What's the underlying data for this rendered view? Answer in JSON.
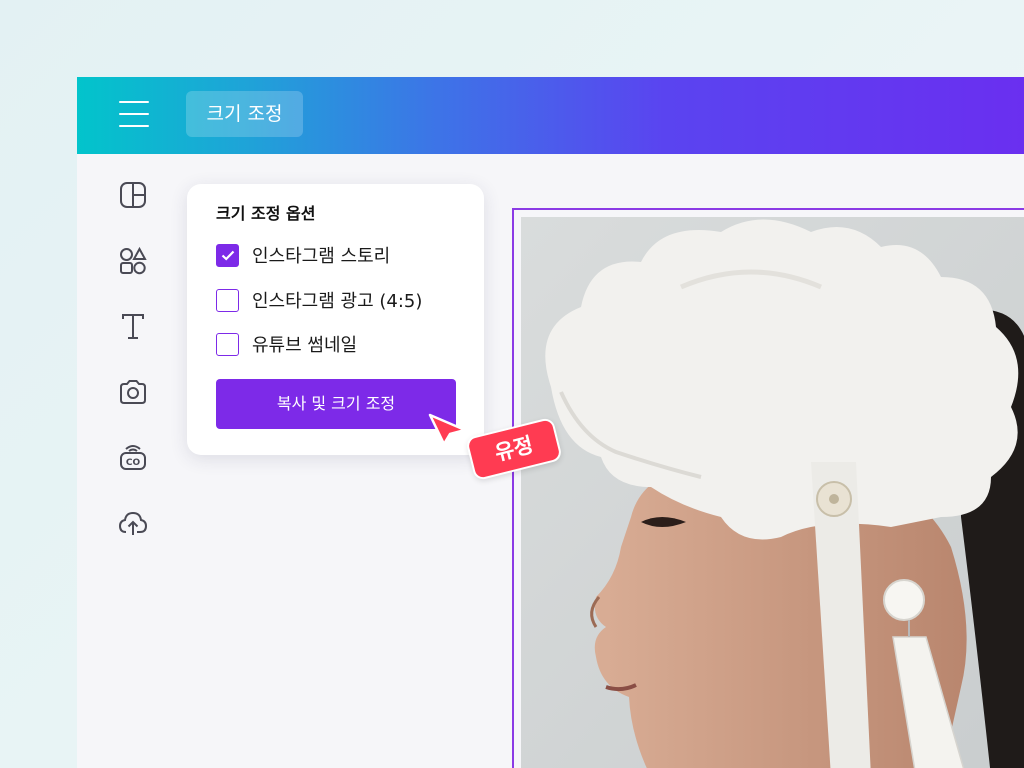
{
  "topbar": {
    "menu_icon": "hamburger-icon",
    "resize_tab_label": "크기 조정"
  },
  "sidebar": {
    "items": [
      {
        "name": "templates",
        "icon": "layout-icon"
      },
      {
        "name": "elements",
        "icon": "shapes-icon"
      },
      {
        "name": "text",
        "icon": "text-icon"
      },
      {
        "name": "photos",
        "icon": "camera-icon"
      },
      {
        "name": "brand",
        "icon": "co-icon"
      },
      {
        "name": "uploads",
        "icon": "cloud-upload-icon"
      }
    ]
  },
  "resize_panel": {
    "title": "크기 조정 옵션",
    "options": [
      {
        "label": "인스타그램 스토리",
        "checked": true
      },
      {
        "label": "인스타그램 광고 (4:5)",
        "checked": false
      },
      {
        "label": "유튜브 썸네일",
        "checked": false
      }
    ],
    "button_label": "복사 및 크기 조정"
  },
  "cursor": {
    "user_label": "유정",
    "color": "#ff3b52"
  },
  "colors": {
    "accent": "#7d2ae8",
    "topbar_start": "#02c4cb",
    "topbar_end": "#6a2ff0"
  }
}
